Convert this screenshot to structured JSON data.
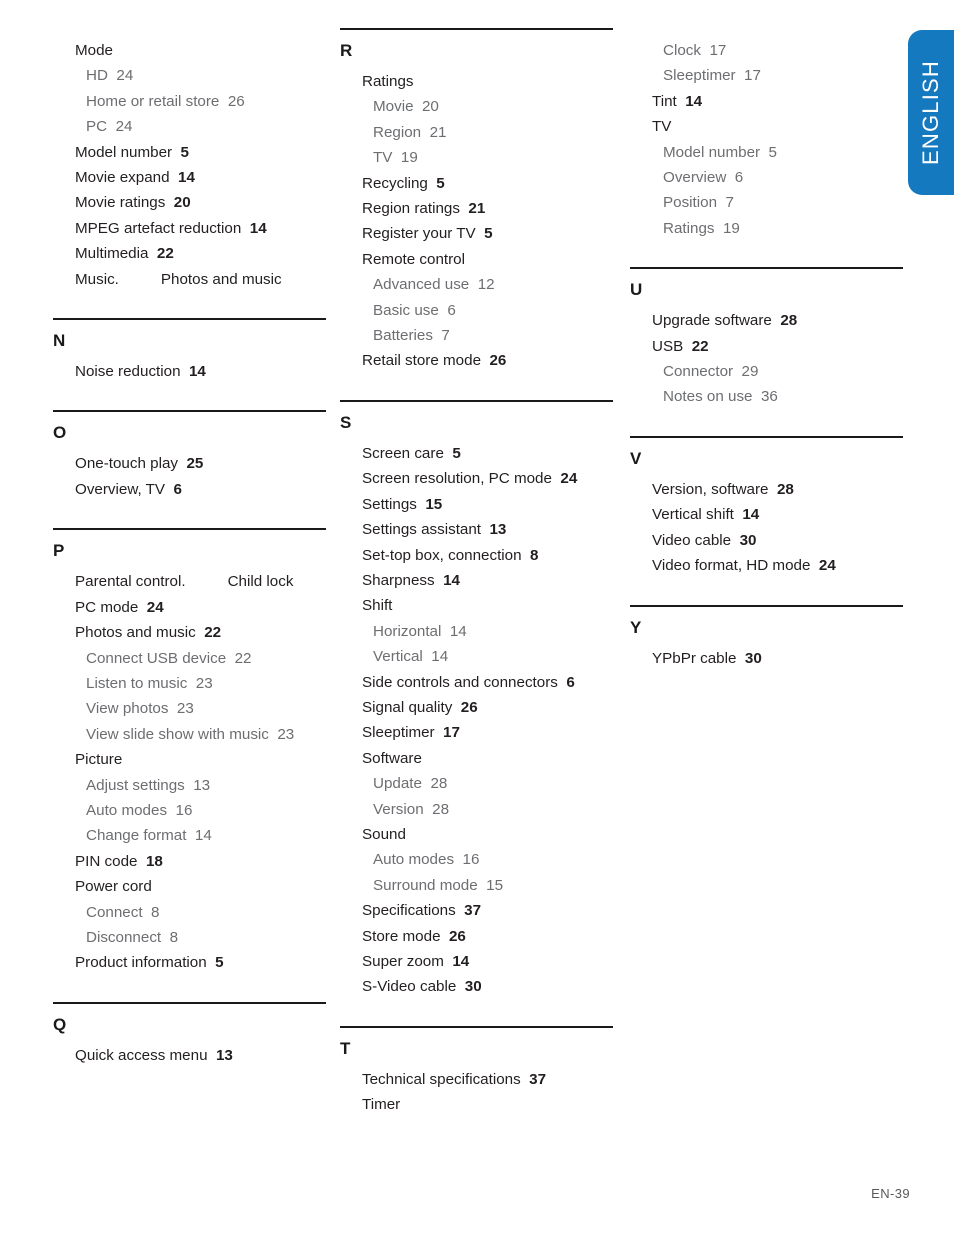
{
  "language_tab": {
    "label": "ENGLISH",
    "color": "#1579c0"
  },
  "footer": {
    "page_label": "EN-39"
  },
  "columns": [
    {
      "id": "column-1",
      "blocks": [
        {
          "letter": "",
          "has_rule": false,
          "entries": [
            {
              "level": 1,
              "text": "Mode",
              "page": ""
            },
            {
              "level": 2,
              "text": "HD",
              "page": "24"
            },
            {
              "level": 2,
              "text": "Home or retail store",
              "page": "26"
            },
            {
              "level": 2,
              "text": "PC",
              "page": "24"
            },
            {
              "level": 1,
              "text": "Model number",
              "page": "5"
            },
            {
              "level": 1,
              "text": "Movie expand",
              "page": "14"
            },
            {
              "level": 1,
              "text": "Movie ratings",
              "page": "20"
            },
            {
              "level": 1,
              "text": "MPEG artefact reduction",
              "page": "14"
            },
            {
              "level": 1,
              "text": "Multimedia",
              "page": "22"
            },
            {
              "level": 1,
              "text": "Music.",
              "page": "",
              "xref": "Photos and music"
            }
          ]
        },
        {
          "letter": "N",
          "has_rule": true,
          "entries": [
            {
              "level": 1,
              "text": "Noise reduction",
              "page": "14"
            }
          ]
        },
        {
          "letter": "O",
          "has_rule": true,
          "entries": [
            {
              "level": 1,
              "text": "One-touch play",
              "page": "25"
            },
            {
              "level": 1,
              "text": "Overview, TV",
              "page": "6"
            }
          ]
        },
        {
          "letter": "P",
          "has_rule": true,
          "entries": [
            {
              "level": 1,
              "text": "Parental control.",
              "page": "",
              "xref": "Child lock"
            },
            {
              "level": 1,
              "text": "PC mode",
              "page": "24"
            },
            {
              "level": 1,
              "text": "Photos and music",
              "page": "22"
            },
            {
              "level": 2,
              "text": "Connect USB device",
              "page": "22"
            },
            {
              "level": 2,
              "text": "Listen to music",
              "page": "23"
            },
            {
              "level": 2,
              "text": "View photos",
              "page": "23"
            },
            {
              "level": 2,
              "text": "View slide show with music",
              "page": "23"
            },
            {
              "level": 1,
              "text": "Picture",
              "page": ""
            },
            {
              "level": 2,
              "text": "Adjust settings",
              "page": "13"
            },
            {
              "level": 2,
              "text": "Auto modes",
              "page": "16"
            },
            {
              "level": 2,
              "text": "Change format",
              "page": "14"
            },
            {
              "level": 1,
              "text": "PIN code",
              "page": "18"
            },
            {
              "level": 1,
              "text": "Power cord",
              "page": ""
            },
            {
              "level": 2,
              "text": "Connect",
              "page": "8"
            },
            {
              "level": 2,
              "text": "Disconnect",
              "page": "8"
            },
            {
              "level": 1,
              "text": "Product information",
              "page": "5"
            }
          ]
        },
        {
          "letter": "Q",
          "has_rule": true,
          "entries": [
            {
              "level": 1,
              "text": "Quick access menu",
              "page": "13"
            }
          ]
        }
      ]
    },
    {
      "id": "column-2",
      "blocks": [
        {
          "letter": "R",
          "has_rule": true,
          "entries": [
            {
              "level": 1,
              "text": "Ratings",
              "page": ""
            },
            {
              "level": 2,
              "text": "Movie",
              "page": "20"
            },
            {
              "level": 2,
              "text": "Region",
              "page": "21"
            },
            {
              "level": 2,
              "text": "TV",
              "page": "19"
            },
            {
              "level": 1,
              "text": "Recycling",
              "page": "5"
            },
            {
              "level": 1,
              "text": "Region ratings",
              "page": "21"
            },
            {
              "level": 1,
              "text": "Register your TV",
              "page": "5"
            },
            {
              "level": 1,
              "text": "Remote control",
              "page": ""
            },
            {
              "level": 2,
              "text": "Advanced use",
              "page": "12"
            },
            {
              "level": 2,
              "text": "Basic use",
              "page": "6"
            },
            {
              "level": 2,
              "text": "Batteries",
              "page": "7"
            },
            {
              "level": 1,
              "text": "Retail store mode",
              "page": "26"
            }
          ]
        },
        {
          "letter": "S",
          "has_rule": true,
          "entries": [
            {
              "level": 1,
              "text": "Screen care",
              "page": "5"
            },
            {
              "level": 1,
              "text": "Screen resolution, PC mode",
              "page": "24"
            },
            {
              "level": 1,
              "text": "Settings",
              "page": "15"
            },
            {
              "level": 1,
              "text": "Settings assistant",
              "page": "13"
            },
            {
              "level": 1,
              "text": "Set-top box, connection",
              "page": "8"
            },
            {
              "level": 1,
              "text": "Sharpness",
              "page": "14"
            },
            {
              "level": 1,
              "text": "Shift",
              "page": ""
            },
            {
              "level": 2,
              "text": "Horizontal",
              "page": "14"
            },
            {
              "level": 2,
              "text": "Vertical",
              "page": "14"
            },
            {
              "level": 1,
              "text": "Side controls and connectors",
              "page": "6"
            },
            {
              "level": 1,
              "text": "Signal quality",
              "page": "26"
            },
            {
              "level": 1,
              "text": "Sleeptimer",
              "page": "17"
            },
            {
              "level": 1,
              "text": "Software",
              "page": ""
            },
            {
              "level": 2,
              "text": "Update",
              "page": "28"
            },
            {
              "level": 2,
              "text": "Version",
              "page": "28"
            },
            {
              "level": 1,
              "text": "Sound",
              "page": ""
            },
            {
              "level": 2,
              "text": "Auto modes",
              "page": "16"
            },
            {
              "level": 2,
              "text": "Surround mode",
              "page": "15"
            },
            {
              "level": 1,
              "text": "Specifications",
              "page": "37"
            },
            {
              "level": 1,
              "text": "Store mode",
              "page": "26"
            },
            {
              "level": 1,
              "text": "Super zoom",
              "page": "14"
            },
            {
              "level": 1,
              "text": "S-Video cable",
              "page": "30"
            }
          ]
        },
        {
          "letter": "T",
          "has_rule": true,
          "entries": [
            {
              "level": 1,
              "text": "Technical specifications",
              "page": "37"
            },
            {
              "level": 1,
              "text": "Timer",
              "page": ""
            }
          ]
        }
      ]
    },
    {
      "id": "column-3",
      "blocks": [
        {
          "letter": "",
          "has_rule": false,
          "entries": [
            {
              "level": 2,
              "text": "Clock",
              "page": "17"
            },
            {
              "level": 2,
              "text": "Sleeptimer",
              "page": "17"
            },
            {
              "level": 1,
              "text": "Tint",
              "page": "14"
            },
            {
              "level": 1,
              "text": "TV",
              "page": ""
            },
            {
              "level": 2,
              "text": "Model number",
              "page": "5"
            },
            {
              "level": 2,
              "text": "Overview",
              "page": "6"
            },
            {
              "level": 2,
              "text": "Position",
              "page": "7"
            },
            {
              "level": 2,
              "text": "Ratings",
              "page": "19"
            }
          ]
        },
        {
          "letter": "U",
          "has_rule": true,
          "entries": [
            {
              "level": 1,
              "text": "Upgrade software",
              "page": "28"
            },
            {
              "level": 1,
              "text": "USB",
              "page": "22"
            },
            {
              "level": 2,
              "text": "Connector",
              "page": "29"
            },
            {
              "level": 2,
              "text": "Notes on use",
              "page": "36"
            }
          ]
        },
        {
          "letter": "V",
          "has_rule": true,
          "entries": [
            {
              "level": 1,
              "text": "Version, software",
              "page": "28"
            },
            {
              "level": 1,
              "text": "Vertical shift",
              "page": "14"
            },
            {
              "level": 1,
              "text": "Video cable",
              "page": "30"
            },
            {
              "level": 1,
              "text": "Video format, HD mode",
              "page": "24"
            }
          ]
        },
        {
          "letter": "Y",
          "has_rule": true,
          "entries": [
            {
              "level": 1,
              "text": "YPbPr cable",
              "page": "30"
            }
          ]
        }
      ]
    }
  ]
}
